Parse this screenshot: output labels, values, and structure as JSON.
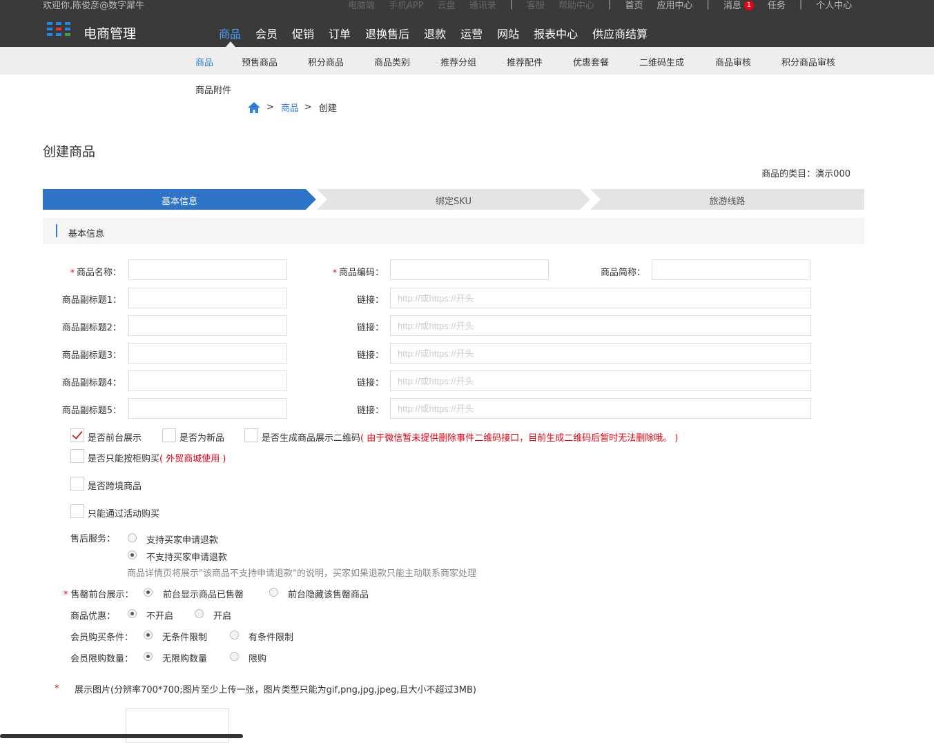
{
  "header": {
    "welcome": "欢迎你,陈俊彦@数字犀牛",
    "links_dim": [
      "电脑端",
      "手机APP",
      "云盘",
      "通讯录"
    ],
    "links_mid": [
      "客服",
      "帮助中心"
    ],
    "home": "首页",
    "app_center": "应用中心",
    "messages": "消息",
    "message_count": "1",
    "tasks": "任务",
    "profile": "个人中心",
    "brand": "电商管理",
    "logo_colors": [
      "#1e88e5",
      "#43a047",
      "#e53935",
      "#fb8c00"
    ]
  },
  "mainnav": [
    "商品",
    "会员",
    "促销",
    "订单",
    "退换售后",
    "退款",
    "运营",
    "网站",
    "报表中心",
    "供应商结算"
  ],
  "subnav": [
    "商品",
    "预售商品",
    "积分商品",
    "商品类别",
    "推荐分组",
    "推荐配件",
    "优惠套餐",
    "二维码生成",
    "商品审核",
    "积分商品审核"
  ],
  "subnav_row2": "商品附件",
  "breadcrumb": {
    "gt": ">",
    "section": "商品",
    "current": "创建"
  },
  "page": {
    "title": "创建商品",
    "category": "商品的类目：演示000"
  },
  "steps": [
    "基本信息",
    "绑定SKU",
    "旅游线路"
  ],
  "section_title": "基本信息",
  "form": {
    "req_mark": "*",
    "name_label": "商品名称：",
    "code_label": "商品编码：",
    "short_label": "商品简称：",
    "subtitle_labels": [
      "商品副标题1：",
      "商品副标题2：",
      "商品副标题3：",
      "商品副标题4：",
      "商品副标题5："
    ],
    "link_label": "链接：",
    "link_placeholder": "http://或https://开头",
    "cb_front": "是否前台展示",
    "cb_new": "是否为新品",
    "cb_qr": "是否生成商品展示二维码",
    "cb_qr_note": "( 由于微信暂未提供删除事件二维码接口，目前生成二维码后暂时无法删除哦。 )",
    "cb_box": "是否只能按柜购买",
    "cb_box_note": "( 外贸商城使用 )",
    "cb_cross": "是否跨境商品",
    "cb_activity": "只能通过活动购买",
    "aftersale_label": "售后服务：",
    "aftersale_opt1": "支持买家申请退款",
    "aftersale_opt2": "不支持买家申请退款",
    "aftersale_note": "商品详情页将展示\"该商品不支持申请退款\"的说明，买家如果退款只能主动联系商家处理",
    "soldout_label": "售罄前台展示：",
    "soldout_opt1": "前台显示商品已售罄",
    "soldout_opt2": "前台隐藏该售罄商品",
    "discount_label": "商品优惠：",
    "discount_opt1": "不开启",
    "discount_opt2": "开启",
    "member_cond_label": "会员购买条件：",
    "member_cond_opt1": "无条件限制",
    "member_cond_opt2": "有条件限制",
    "member_limit_label": "会员限购数量：",
    "member_limit_opt1": "无限购数量",
    "member_limit_opt2": "限购",
    "image_label": "展示图片(分辨率700*700;图片至少上传一张，图片类型只能为gif,png,jpg,jpeg,且大小不超过3MB)"
  }
}
